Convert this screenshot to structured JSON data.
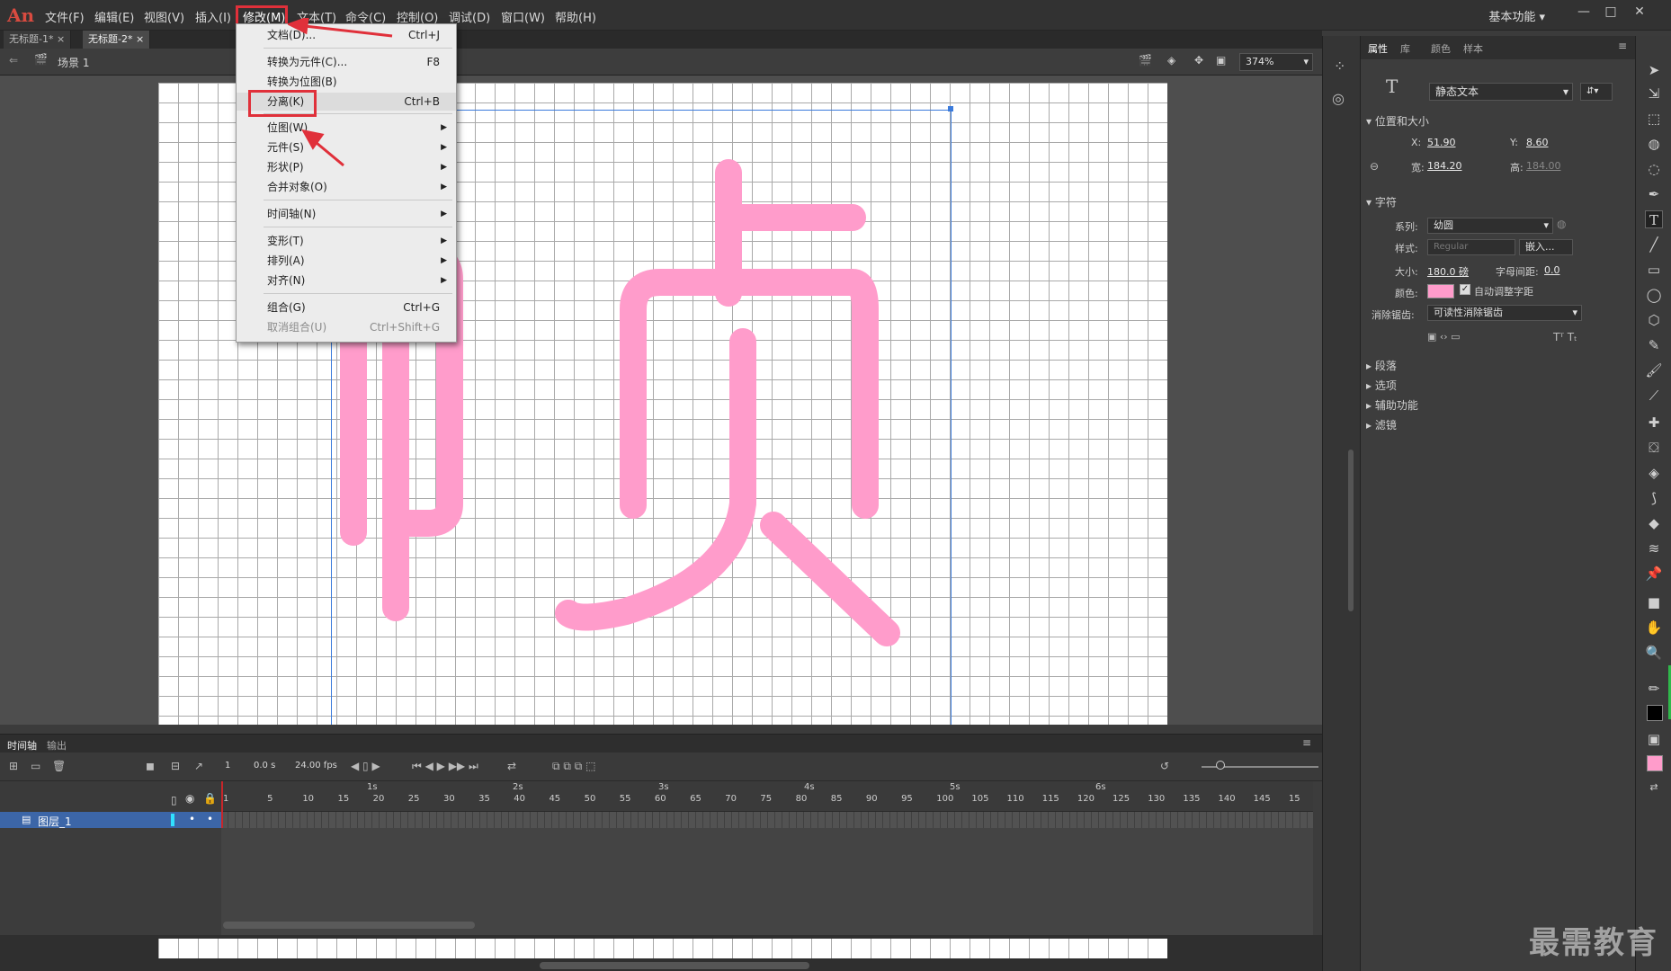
{
  "app": {
    "logo": "An"
  },
  "menubar": {
    "items": [
      "文件(F)",
      "编辑(E)",
      "视图(V)",
      "插入(I)",
      "修改(M)",
      "文本(T)",
      "命令(C)",
      "控制(O)",
      "调试(D)",
      "窗口(W)",
      "帮助(H)"
    ],
    "workspace": "基本功能"
  },
  "tabs": [
    "无标题-1*",
    "无标题-2*"
  ],
  "scene": {
    "label": "场景 1",
    "zoom": "374%"
  },
  "glyph": {
    "text": "帧",
    "color": "#ff9ccb"
  },
  "modify_menu": {
    "items": [
      {
        "label": "文档(D)...",
        "shortcut": "Ctrl+J"
      },
      {
        "label": "转换为元件(C)...",
        "shortcut": "F8"
      },
      {
        "label": "转换为位图(B)",
        "shortcut": ""
      },
      {
        "label": "分离(K)",
        "shortcut": "Ctrl+B"
      },
      {
        "label": "位图(W)",
        "shortcut": ""
      },
      {
        "label": "元件(S)",
        "shortcut": ""
      },
      {
        "label": "形状(P)",
        "shortcut": ""
      },
      {
        "label": "合并对象(O)",
        "shortcut": ""
      },
      {
        "label": "时间轴(N)",
        "shortcut": ""
      },
      {
        "label": "变形(T)",
        "shortcut": ""
      },
      {
        "label": "排列(A)",
        "shortcut": ""
      },
      {
        "label": "对齐(N)",
        "shortcut": ""
      },
      {
        "label": "组合(G)",
        "shortcut": "Ctrl+G"
      },
      {
        "label": "取消组合(U)",
        "shortcut": "Ctrl+Shift+G"
      }
    ]
  },
  "timeline": {
    "tabs": [
      "时间轴",
      "输出"
    ],
    "frame": "1",
    "time": "0.0 s",
    "fps": "24.00 fps",
    "layer": "图层_1",
    "seconds": [
      "1s",
      "2s",
      "3s",
      "4s",
      "5s",
      "6s"
    ],
    "frame_ticks": [
      "1",
      "5",
      "10",
      "15",
      "20",
      "25",
      "30",
      "35",
      "40",
      "45",
      "50",
      "55",
      "60",
      "65",
      "70",
      "75",
      "80",
      "85",
      "90",
      "95",
      "100",
      "105",
      "110",
      "115",
      "120",
      "125",
      "130",
      "135",
      "140",
      "145",
      "15"
    ]
  },
  "props": {
    "tabs": [
      "属性",
      "库",
      "颜色",
      "样本"
    ],
    "text_type": "静态文本",
    "pos_section": "位置和大小",
    "x_label": "X:",
    "x": "51.90",
    "y_label": "Y:",
    "y": "8.60",
    "w_label": "宽:",
    "w": "184.20",
    "h_label": "高:",
    "h": "184.00",
    "char_section": "字符",
    "family_label": "系列:",
    "family": "幼圆",
    "style_label": "样式:",
    "style": "Regular",
    "embed": "嵌入...",
    "size_label": "大小:",
    "size": "180.0 磅",
    "spacing_label": "字母间距:",
    "spacing": "0.0",
    "color_label": "颜色:",
    "color": "#ff9ccb",
    "autokern": "自动调整字距",
    "aa_label": "消除锯齿:",
    "aa": "可读性消除锯齿",
    "sections": [
      "段落",
      "选项",
      "辅助功能",
      "滤镜"
    ]
  },
  "watermark": "最需教育"
}
